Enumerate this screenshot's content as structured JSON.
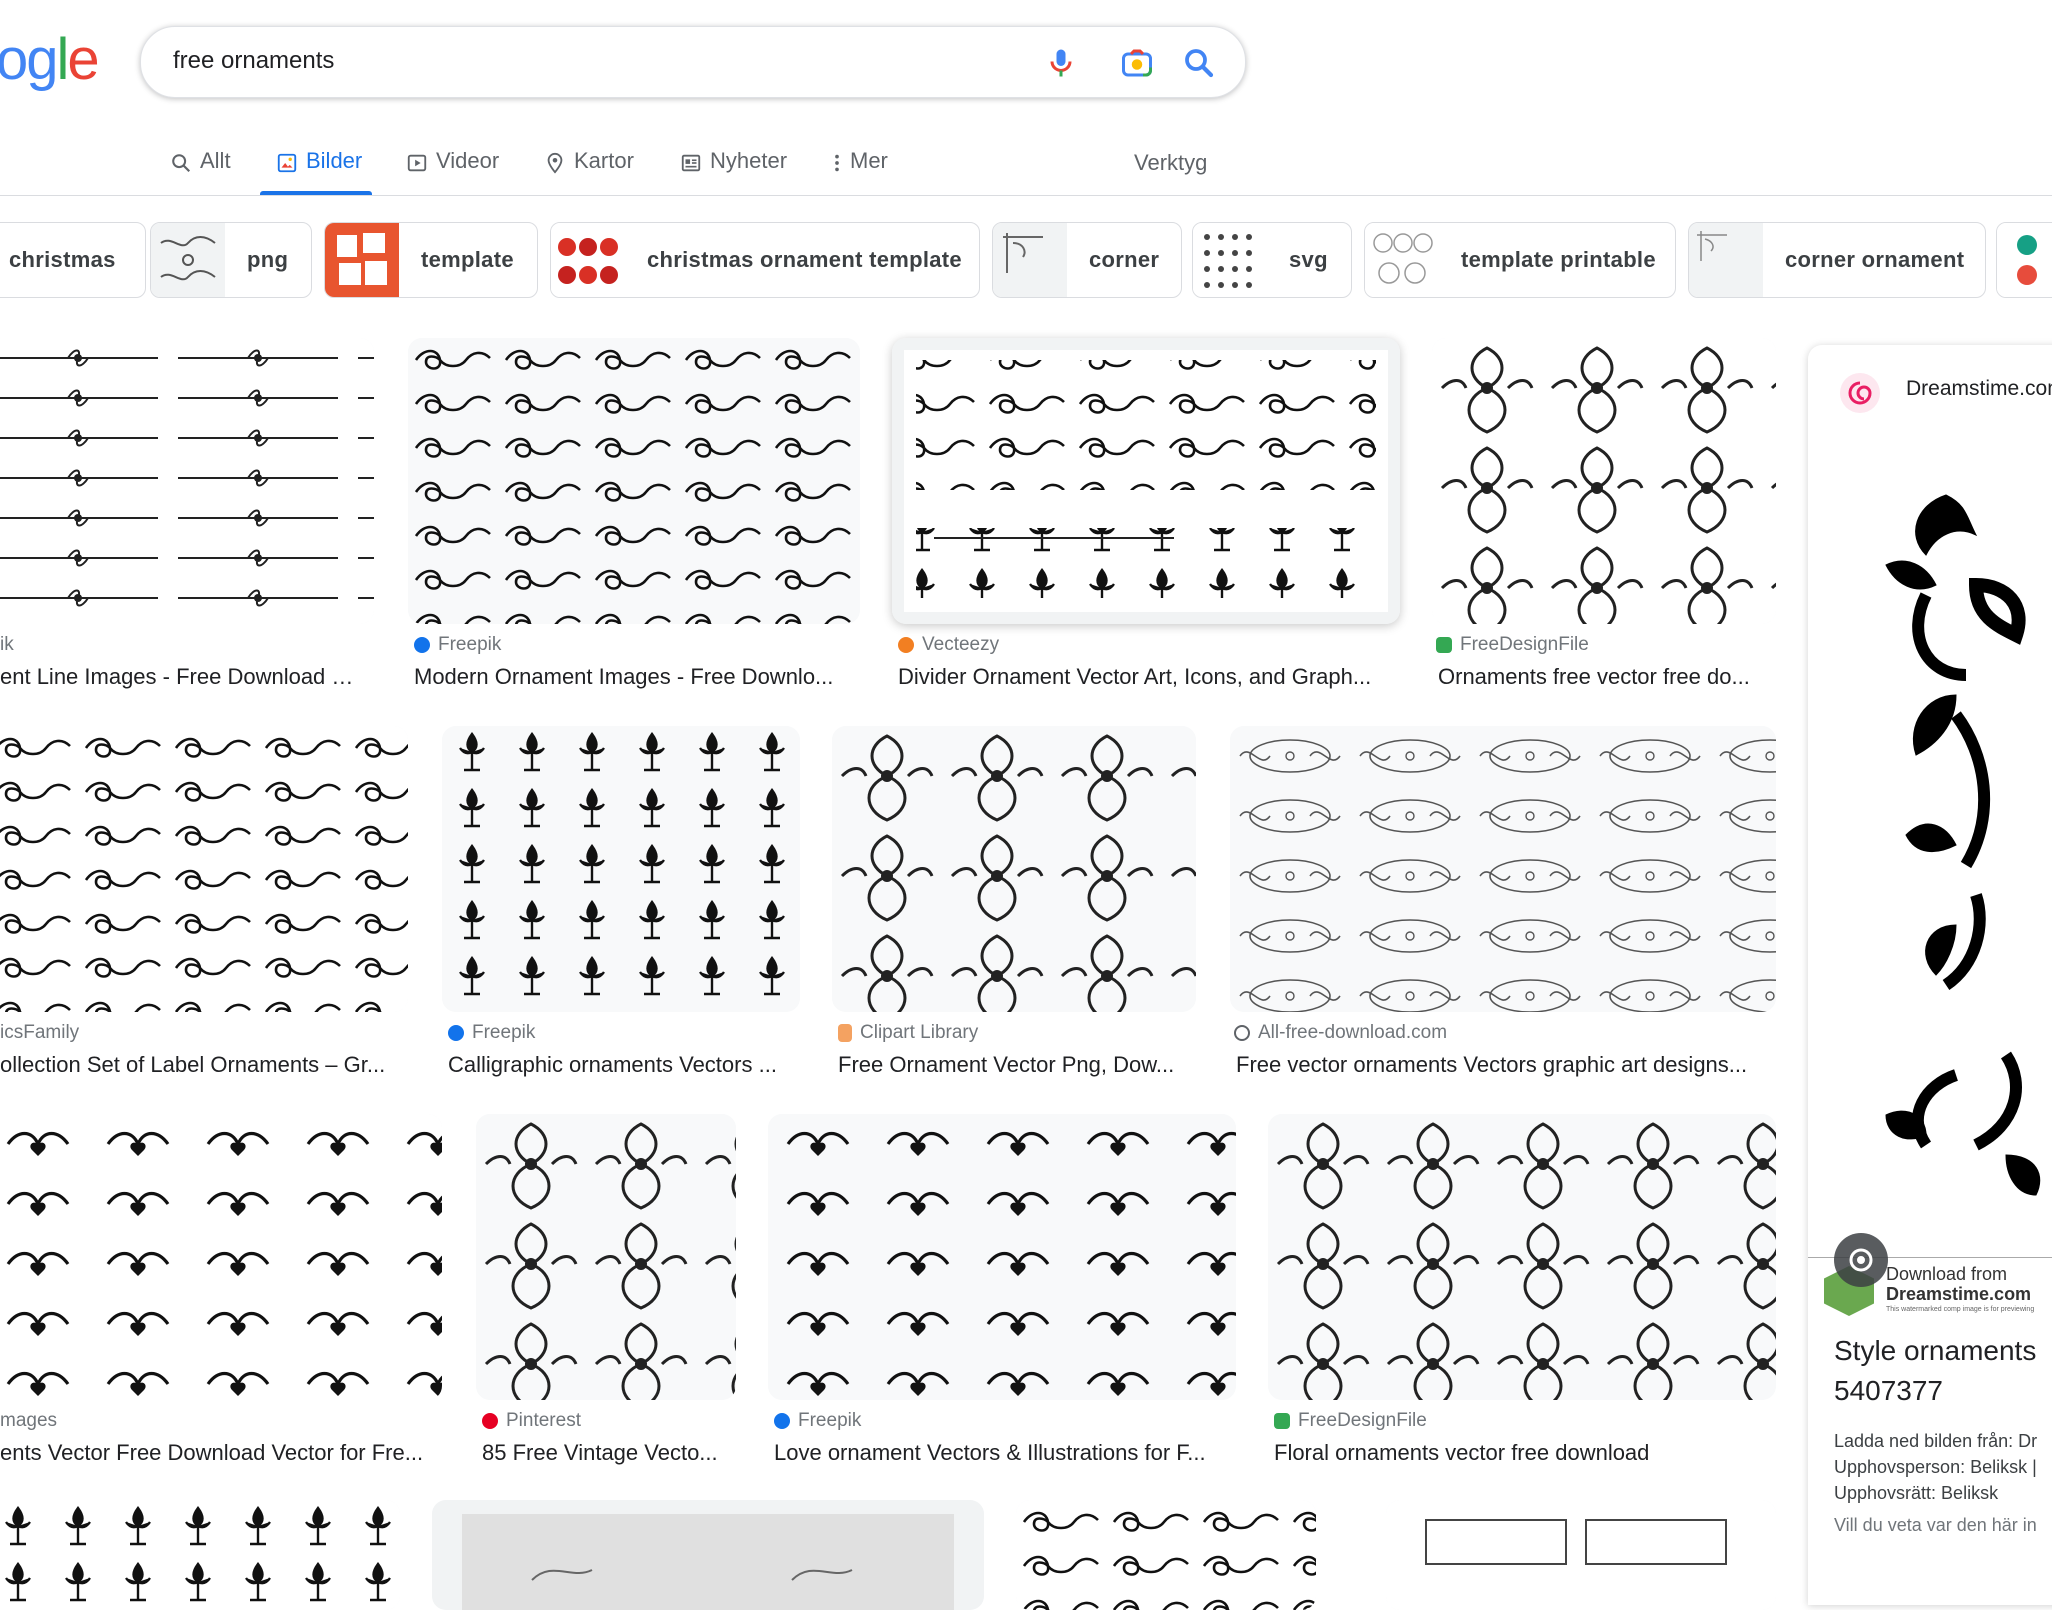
{
  "search": {
    "query": "free ornaments",
    "logo_text": "ogle"
  },
  "tabs": [
    {
      "label": "Allt",
      "icon": "search-icon"
    },
    {
      "label": "Bilder",
      "icon": "image-icon",
      "active": true
    },
    {
      "label": "Videor",
      "icon": "play-icon"
    },
    {
      "label": "Kartor",
      "icon": "map-pin-icon"
    },
    {
      "label": "Nyheter",
      "icon": "news-icon"
    },
    {
      "label": "Mer",
      "icon": "more-vertical-icon"
    }
  ],
  "tools_label": "Verktyg",
  "chips": [
    "christmas",
    "png",
    "template",
    "christmas ornament template",
    "corner",
    "svg",
    "template printable",
    "corner ornament"
  ],
  "results": {
    "row1": [
      {
        "source": "ik",
        "title": "ent Line Images - Free Download o..."
      },
      {
        "source": "Freepik",
        "title": "Modern Ornament Images - Free Downlo..."
      },
      {
        "source": "Vecteezy",
        "title": "Divider Ornament Vector Art, Icons, and Graph..."
      },
      {
        "source": "FreeDesignFile",
        "title": "Ornaments free vector free do..."
      }
    ],
    "row2": [
      {
        "source": "icsFamily",
        "title": "ollection Set of Label Ornaments – Gr..."
      },
      {
        "source": "Freepik",
        "title": "Calligraphic ornaments Vectors ..."
      },
      {
        "source": "Clipart Library",
        "title": "Free Ornament Vector Png, Dow..."
      },
      {
        "source": "All-free-download.com",
        "title": "Free vector ornaments Vectors graphic art designs..."
      }
    ],
    "row3": [
      {
        "source": "mages",
        "title": "ents Vector Free Download Vector for Fre..."
      },
      {
        "source": "Pinterest",
        "title": "85 Free Vintage Vecto..."
      },
      {
        "source": "Freepik",
        "title": "Love ornament Vectors & Illustrations for F..."
      },
      {
        "source": "FreeDesignFile",
        "title": "Floral ornaments vector free download"
      }
    ]
  },
  "panel": {
    "site": "Dreamstime.com",
    "title_line1": "Style ornaments",
    "title_line2": "5407377",
    "download_from": "Download from",
    "download_site": "Dreamstime.com",
    "download_note": "This watermarked comp image is for previewing",
    "line_download": "Ladda ned bilden från: Dr",
    "line_author": "Upphovsperson: Beliksk |",
    "line_rights": "Upphovsrätt: Beliksk",
    "line_question": "Vill du veta var den här in"
  },
  "colors": {
    "google_blue": "#4285f4",
    "google_red": "#ea4335",
    "google_yellow": "#fbbc05",
    "google_green": "#34a853",
    "active_tab": "#1a73e8"
  }
}
